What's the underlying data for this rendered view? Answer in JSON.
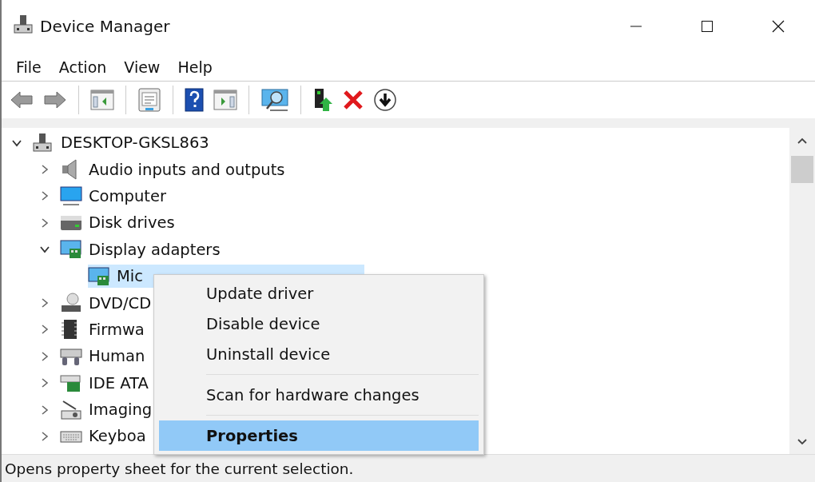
{
  "window": {
    "title": "Device Manager"
  },
  "menu_bar": [
    "File",
    "Action",
    "View",
    "Help"
  ],
  "toolbar": [
    {
      "kind": "back",
      "disabled": true
    },
    {
      "kind": "forward",
      "disabled": true
    },
    {
      "kind": "separator"
    },
    {
      "kind": "tree-pane"
    },
    {
      "kind": "separator"
    },
    {
      "kind": "sheet"
    },
    {
      "kind": "separator"
    },
    {
      "kind": "help"
    },
    {
      "kind": "action-pane"
    },
    {
      "kind": "separator"
    },
    {
      "kind": "scan"
    },
    {
      "kind": "separator"
    },
    {
      "kind": "update"
    },
    {
      "kind": "remove"
    },
    {
      "kind": "install"
    }
  ],
  "tree": [
    {
      "label": "DESKTOP-GKSL863",
      "expanded": true,
      "selected": false,
      "children": [
        {
          "label": "Audio inputs and outputs",
          "expanded": false,
          "selected": false
        },
        {
          "label": "Computer",
          "expanded": false,
          "selected": false
        },
        {
          "label": "Disk drives",
          "expanded": false,
          "selected": false
        },
        {
          "label": "Display adapters",
          "expanded": true,
          "selected": false,
          "children": [
            {
              "label": "Mic",
              "selected": true
            }
          ]
        },
        {
          "label": "DVD/CD",
          "expanded": false,
          "selected": false
        },
        {
          "label": "Firmwa",
          "expanded": false,
          "selected": false
        },
        {
          "label": "Human",
          "expanded": false,
          "selected": false
        },
        {
          "label": "IDE ATA",
          "expanded": false,
          "selected": false
        },
        {
          "label": "Imaging",
          "expanded": false,
          "selected": false
        },
        {
          "label": "Keyboa",
          "expanded": false,
          "selected": false
        }
      ]
    }
  ],
  "context_menu": [
    {
      "label": "Update driver",
      "selected": false,
      "separator_before": false
    },
    {
      "label": "Disable device",
      "selected": false,
      "separator_before": false
    },
    {
      "label": "Uninstall device",
      "selected": false,
      "separator_before": false
    },
    {
      "label": "Scan for hardware changes",
      "selected": false,
      "separator_before": true
    },
    {
      "label": "Properties",
      "selected": true,
      "separator_before": true
    }
  ],
  "status_bar": "Opens property sheet for the current selection."
}
